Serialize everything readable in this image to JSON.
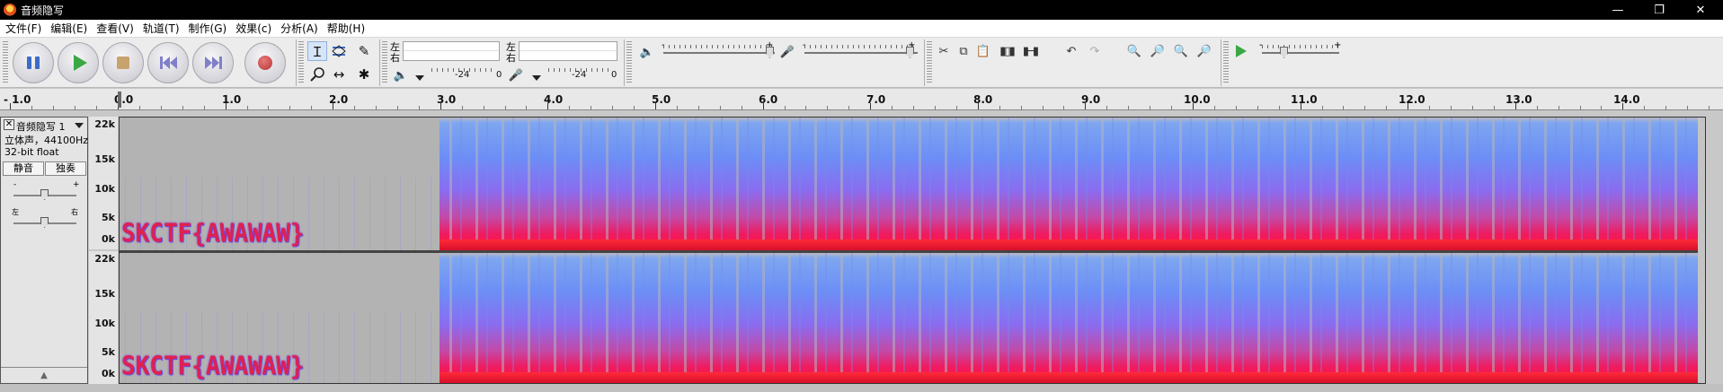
{
  "window": {
    "title": "音频隐写",
    "minimize": "—",
    "maximize": "❐",
    "close": "✕"
  },
  "menu": [
    "文件(F)",
    "编辑(E)",
    "查看(V)",
    "轨道(T)",
    "制作(G)",
    "效果(c)",
    "分析(A)",
    "帮助(H)"
  ],
  "meters": {
    "play_label_top": "左",
    "play_label_bottom": "右",
    "rec_label_top": "左",
    "rec_label_bottom": "右",
    "play_scale_a": "-24",
    "play_scale_b": "0",
    "rec_scale_a": "-24",
    "rec_scale_b": "0"
  },
  "mixer": {
    "vol_minus": "-",
    "vol_plus": "+",
    "speed_minus": "-",
    "speed_plus": "+"
  },
  "ruler": {
    "labels": [
      "- 1.0",
      "0.0",
      "1.0",
      "2.0",
      "3.0",
      "4.0",
      "5.0",
      "6.0",
      "7.0",
      "8.0",
      "9.0",
      "10.0",
      "11.0",
      "12.0",
      "13.0",
      "14.0"
    ]
  },
  "track": {
    "close": "✕",
    "name": "音频隐写 1",
    "info_channels": "立体声，44100Hz",
    "info_format": "32-bit float",
    "mute_label": "静音",
    "solo_label": "独奏",
    "gain_minus": "-",
    "gain_plus": "+",
    "pan_left": "左",
    "pan_right": "右",
    "collapse": "▲"
  },
  "frequency_axis": [
    "22k",
    "15k",
    "10k",
    "5k",
    "0k"
  ],
  "hidden_message": "SKCTF{AWAWAW}",
  "colors": {
    "spectrogram_high": "#7ea6f0",
    "spectrogram_mid": "#8a6cf0",
    "spectrogram_low": "#f01a5e",
    "play_green": "#3aa843",
    "record_red": "#b83434",
    "pause_blue": "#3b6cc7"
  },
  "icons": {
    "undo": "↶",
    "redo": "↷"
  }
}
